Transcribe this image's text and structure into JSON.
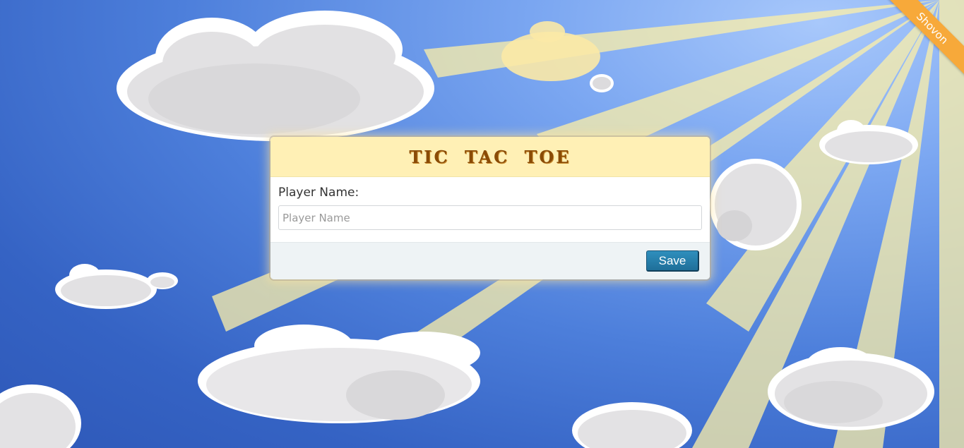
{
  "app": {
    "title": "TIC TAC TOE"
  },
  "ribbon": {
    "label": "Shovon",
    "color": "#f7a93a"
  },
  "form": {
    "label": "Player Name:",
    "placeholder": "Player Name",
    "value": "",
    "save_label": "Save"
  },
  "colors": {
    "header_bg": "#fff0b5",
    "title": "#8a4b06",
    "button": "#2380ad",
    "footer_bg": "#eef3f5",
    "sky": "#4d7fdb",
    "sun_rays": "#fdf0a8",
    "clouds": "#e3e2e4"
  }
}
